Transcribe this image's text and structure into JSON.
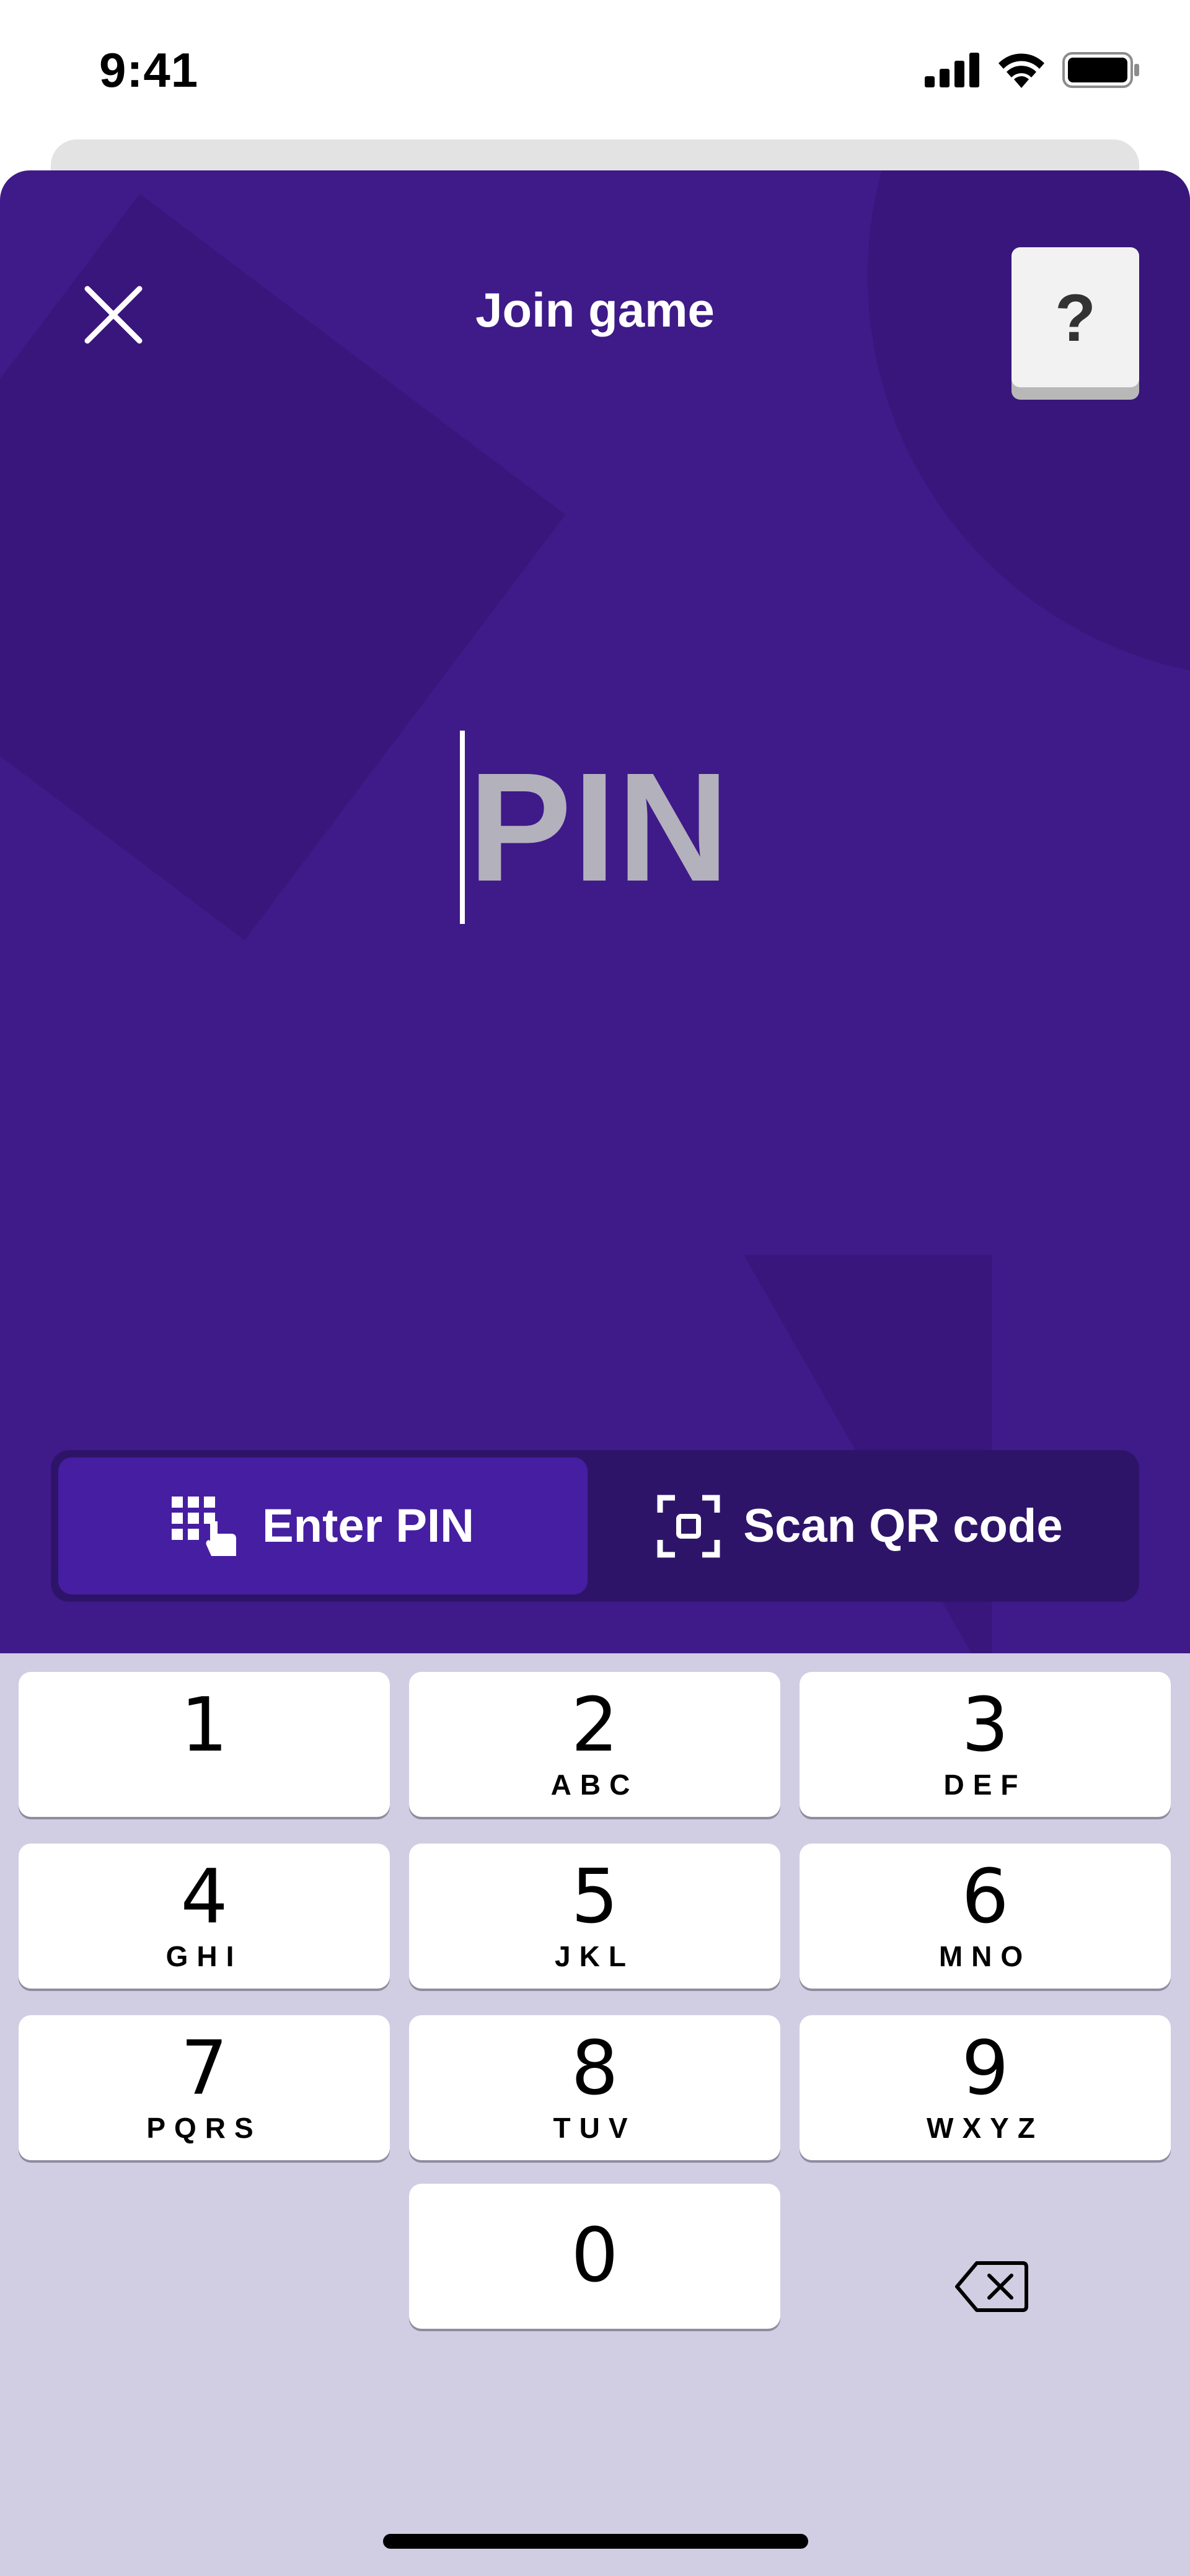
{
  "status_bar": {
    "time": "9:41",
    "icons": [
      "cellular-signal-icon",
      "wifi-icon",
      "battery-icon"
    ]
  },
  "modal": {
    "title": "Join game",
    "close_icon": "close-icon",
    "help_label": "?",
    "pin_placeholder": "PIN",
    "tabs": [
      {
        "label": "Enter PIN",
        "icon": "keypad-icon",
        "active": true
      },
      {
        "label": "Scan QR code",
        "icon": "qr-scan-icon",
        "active": false
      }
    ]
  },
  "keypad": {
    "keys": [
      {
        "digit": "1",
        "letters": ""
      },
      {
        "digit": "2",
        "letters": "ABC"
      },
      {
        "digit": "3",
        "letters": "DEF"
      },
      {
        "digit": "4",
        "letters": "GHI"
      },
      {
        "digit": "5",
        "letters": "JKL"
      },
      {
        "digit": "6",
        "letters": "MNO"
      },
      {
        "digit": "7",
        "letters": "PQRS"
      },
      {
        "digit": "8",
        "letters": "TUV"
      },
      {
        "digit": "9",
        "letters": "WXYZ"
      },
      {
        "digit": "0",
        "letters": ""
      }
    ],
    "backspace_icon": "backspace-icon"
  },
  "colors": {
    "modal_background": "#3f1a89",
    "segment_background": "#2e1469",
    "segment_active": "#461ea1",
    "keypad_background": "#d1cde2",
    "placeholder_text": "#b3b1bb"
  }
}
